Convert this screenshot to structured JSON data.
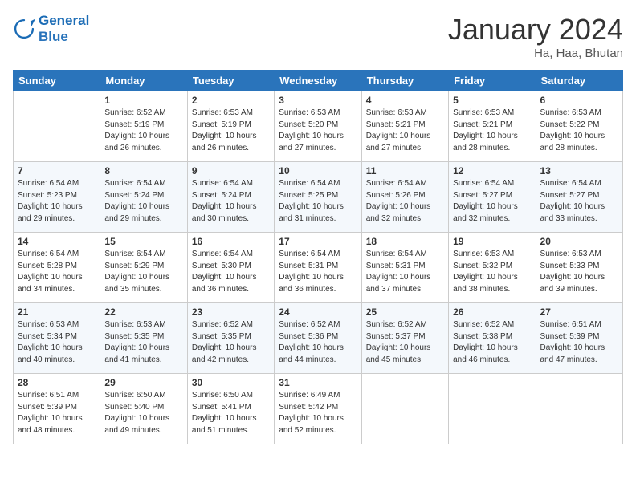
{
  "header": {
    "logo_line1": "General",
    "logo_line2": "Blue",
    "month_title": "January 2024",
    "subtitle": "Ha, Haa, Bhutan"
  },
  "days_of_week": [
    "Sunday",
    "Monday",
    "Tuesday",
    "Wednesday",
    "Thursday",
    "Friday",
    "Saturday"
  ],
  "weeks": [
    [
      {
        "day": "",
        "info": ""
      },
      {
        "day": "1",
        "info": "Sunrise: 6:52 AM\nSunset: 5:19 PM\nDaylight: 10 hours\nand 26 minutes."
      },
      {
        "day": "2",
        "info": "Sunrise: 6:53 AM\nSunset: 5:19 PM\nDaylight: 10 hours\nand 26 minutes."
      },
      {
        "day": "3",
        "info": "Sunrise: 6:53 AM\nSunset: 5:20 PM\nDaylight: 10 hours\nand 27 minutes."
      },
      {
        "day": "4",
        "info": "Sunrise: 6:53 AM\nSunset: 5:21 PM\nDaylight: 10 hours\nand 27 minutes."
      },
      {
        "day": "5",
        "info": "Sunrise: 6:53 AM\nSunset: 5:21 PM\nDaylight: 10 hours\nand 28 minutes."
      },
      {
        "day": "6",
        "info": "Sunrise: 6:53 AM\nSunset: 5:22 PM\nDaylight: 10 hours\nand 28 minutes."
      }
    ],
    [
      {
        "day": "7",
        "info": "Sunrise: 6:54 AM\nSunset: 5:23 PM\nDaylight: 10 hours\nand 29 minutes."
      },
      {
        "day": "8",
        "info": "Sunrise: 6:54 AM\nSunset: 5:24 PM\nDaylight: 10 hours\nand 29 minutes."
      },
      {
        "day": "9",
        "info": "Sunrise: 6:54 AM\nSunset: 5:24 PM\nDaylight: 10 hours\nand 30 minutes."
      },
      {
        "day": "10",
        "info": "Sunrise: 6:54 AM\nSunset: 5:25 PM\nDaylight: 10 hours\nand 31 minutes."
      },
      {
        "day": "11",
        "info": "Sunrise: 6:54 AM\nSunset: 5:26 PM\nDaylight: 10 hours\nand 32 minutes."
      },
      {
        "day": "12",
        "info": "Sunrise: 6:54 AM\nSunset: 5:27 PM\nDaylight: 10 hours\nand 32 minutes."
      },
      {
        "day": "13",
        "info": "Sunrise: 6:54 AM\nSunset: 5:27 PM\nDaylight: 10 hours\nand 33 minutes."
      }
    ],
    [
      {
        "day": "14",
        "info": "Sunrise: 6:54 AM\nSunset: 5:28 PM\nDaylight: 10 hours\nand 34 minutes."
      },
      {
        "day": "15",
        "info": "Sunrise: 6:54 AM\nSunset: 5:29 PM\nDaylight: 10 hours\nand 35 minutes."
      },
      {
        "day": "16",
        "info": "Sunrise: 6:54 AM\nSunset: 5:30 PM\nDaylight: 10 hours\nand 36 minutes."
      },
      {
        "day": "17",
        "info": "Sunrise: 6:54 AM\nSunset: 5:31 PM\nDaylight: 10 hours\nand 36 minutes."
      },
      {
        "day": "18",
        "info": "Sunrise: 6:54 AM\nSunset: 5:31 PM\nDaylight: 10 hours\nand 37 minutes."
      },
      {
        "day": "19",
        "info": "Sunrise: 6:53 AM\nSunset: 5:32 PM\nDaylight: 10 hours\nand 38 minutes."
      },
      {
        "day": "20",
        "info": "Sunrise: 6:53 AM\nSunset: 5:33 PM\nDaylight: 10 hours\nand 39 minutes."
      }
    ],
    [
      {
        "day": "21",
        "info": "Sunrise: 6:53 AM\nSunset: 5:34 PM\nDaylight: 10 hours\nand 40 minutes."
      },
      {
        "day": "22",
        "info": "Sunrise: 6:53 AM\nSunset: 5:35 PM\nDaylight: 10 hours\nand 41 minutes."
      },
      {
        "day": "23",
        "info": "Sunrise: 6:52 AM\nSunset: 5:35 PM\nDaylight: 10 hours\nand 42 minutes."
      },
      {
        "day": "24",
        "info": "Sunrise: 6:52 AM\nSunset: 5:36 PM\nDaylight: 10 hours\nand 44 minutes."
      },
      {
        "day": "25",
        "info": "Sunrise: 6:52 AM\nSunset: 5:37 PM\nDaylight: 10 hours\nand 45 minutes."
      },
      {
        "day": "26",
        "info": "Sunrise: 6:52 AM\nSunset: 5:38 PM\nDaylight: 10 hours\nand 46 minutes."
      },
      {
        "day": "27",
        "info": "Sunrise: 6:51 AM\nSunset: 5:39 PM\nDaylight: 10 hours\nand 47 minutes."
      }
    ],
    [
      {
        "day": "28",
        "info": "Sunrise: 6:51 AM\nSunset: 5:39 PM\nDaylight: 10 hours\nand 48 minutes."
      },
      {
        "day": "29",
        "info": "Sunrise: 6:50 AM\nSunset: 5:40 PM\nDaylight: 10 hours\nand 49 minutes."
      },
      {
        "day": "30",
        "info": "Sunrise: 6:50 AM\nSunset: 5:41 PM\nDaylight: 10 hours\nand 51 minutes."
      },
      {
        "day": "31",
        "info": "Sunrise: 6:49 AM\nSunset: 5:42 PM\nDaylight: 10 hours\nand 52 minutes."
      },
      {
        "day": "",
        "info": ""
      },
      {
        "day": "",
        "info": ""
      },
      {
        "day": "",
        "info": ""
      }
    ]
  ]
}
